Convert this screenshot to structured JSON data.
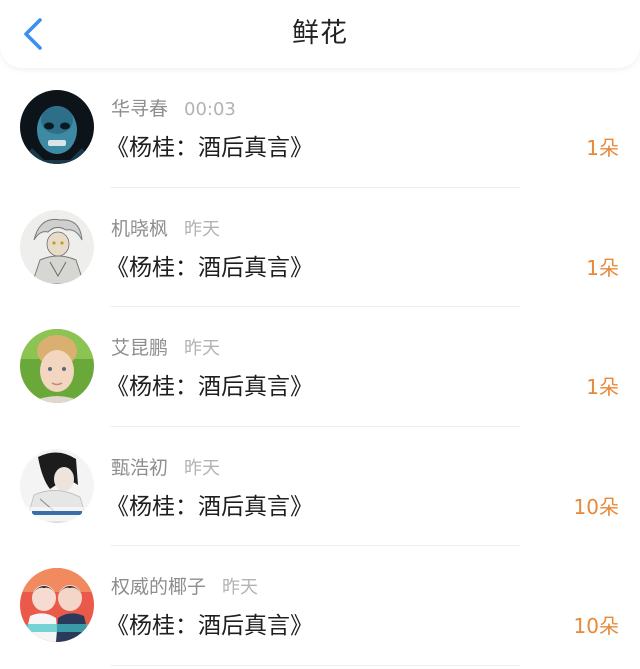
{
  "header": {
    "title": "鲜花",
    "back_icon": "chevron-left-icon"
  },
  "colors": {
    "accent": "#3d8ef0",
    "count": "#e8893a",
    "username": "#8e8e8e",
    "time": "#b3b3b3"
  },
  "items": [
    {
      "user": "华寻春",
      "time": "00:03",
      "work": "《杨桂：酒后真言》",
      "count": "1朵"
    },
    {
      "user": "机晓枫",
      "time": "昨天",
      "work": "《杨桂：酒后真言》",
      "count": "1朵"
    },
    {
      "user": "艾昆鹏",
      "time": "昨天",
      "work": "《杨桂：酒后真言》",
      "count": "1朵"
    },
    {
      "user": "甄浩初",
      "time": "昨天",
      "work": "《杨桂：酒后真言》",
      "count": "10朵"
    },
    {
      "user": "权威的椰子",
      "time": "昨天",
      "work": "《杨桂：酒后真言》",
      "count": "10朵"
    }
  ]
}
